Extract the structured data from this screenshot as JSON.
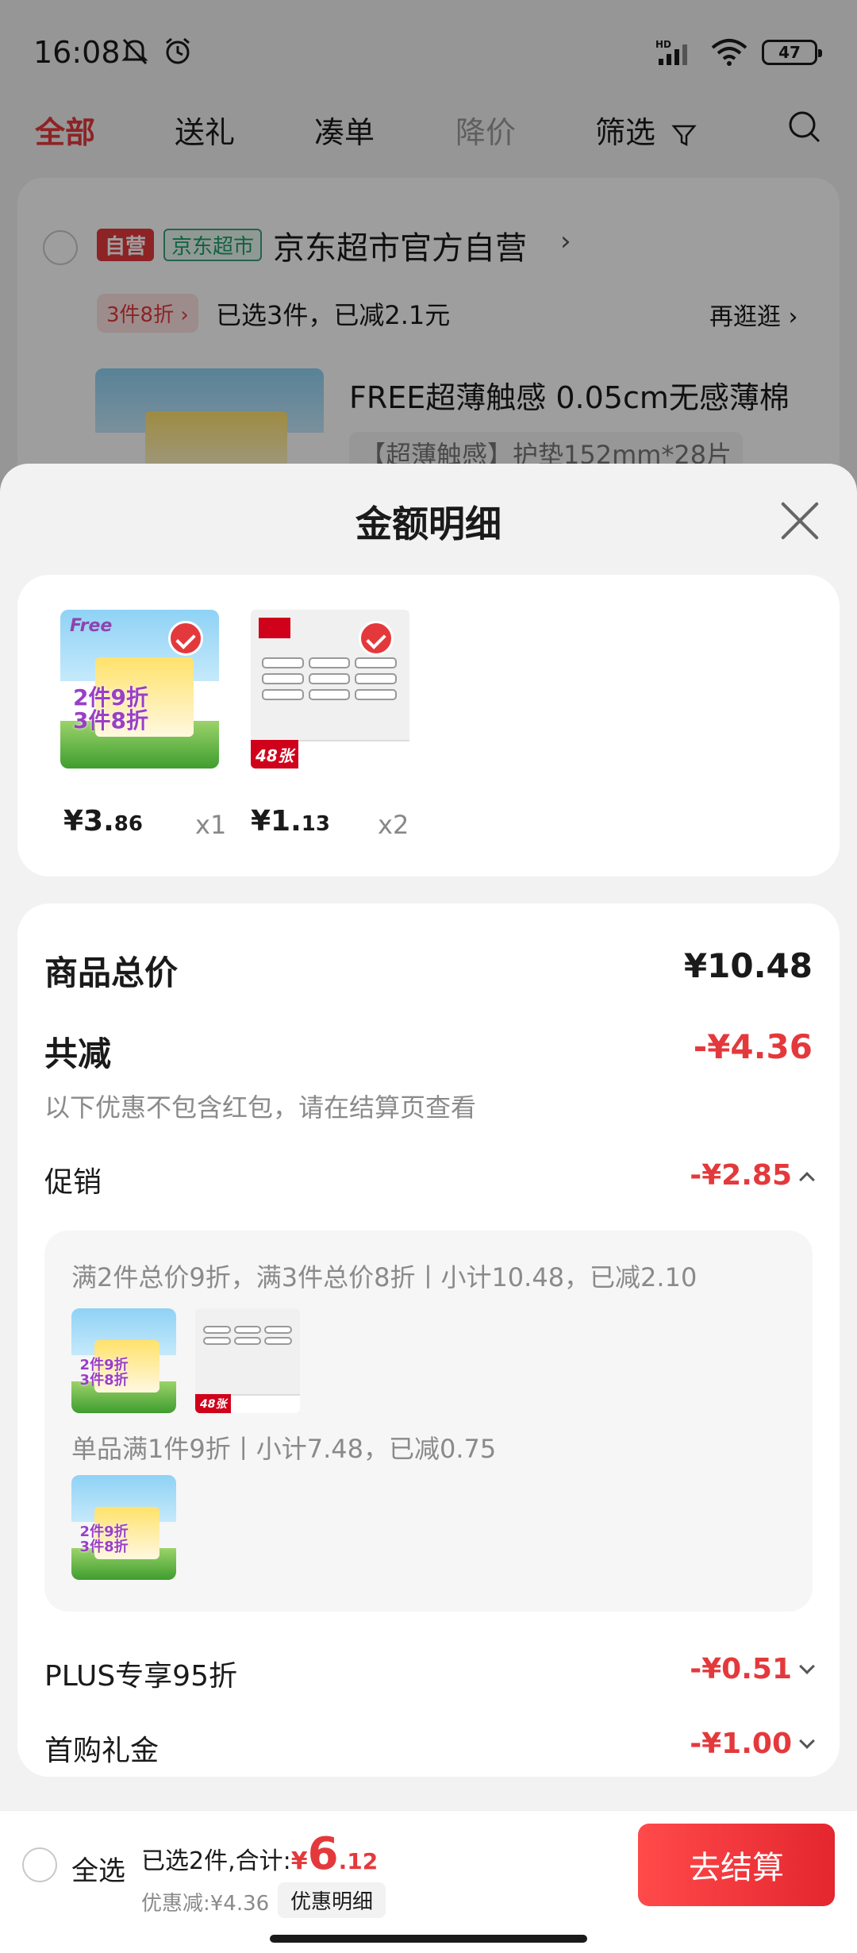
{
  "status_bar": {
    "time": "16:08",
    "battery": "47",
    "network": "HD"
  },
  "filter_tabs": [
    {
      "label": "全部",
      "state": "active"
    },
    {
      "label": "送礼",
      "state": "normal"
    },
    {
      "label": "凑单",
      "state": "normal"
    },
    {
      "label": "降价",
      "state": "disabled"
    },
    {
      "label": "筛选",
      "state": "normal"
    }
  ],
  "shop_card": {
    "tag_self": "自营",
    "tag_store": "京东超市",
    "shop_name": "京东超市官方自营",
    "promo_tag": "3件8折",
    "promo_text": "已选3件，已减2.1元",
    "browse_more": "再逛逛",
    "product_title": "FREE超薄触感 0.05cm无感薄棉",
    "product_spec": "【超薄触感】护垫152mm*28片"
  },
  "sheet": {
    "title": "金额明细",
    "items": [
      {
        "price_int": "¥3.",
        "price_dec": "86",
        "qty": "x1"
      },
      {
        "price_int": "¥1.",
        "price_dec": "13",
        "qty": "x2"
      }
    ],
    "thumb_pad": {
      "logo": "Free",
      "line1": "2件9折",
      "line2": "3件8折"
    },
    "thumb_label": {
      "count": "48张"
    },
    "total_label": "商品总价",
    "total_value": "¥10.48",
    "discount_label": "共减",
    "discount_value": "-¥4.36",
    "discount_note": "以下优惠不包含红包，请在结算页查看",
    "promo_label": "促销",
    "promo_value": "-¥2.85",
    "promo_rule1": "满2件总价9折，满3件总价8折丨小计10.48，已减2.10",
    "promo_rule2": "单品满1件9折丨小计7.48，已减0.75",
    "plus_label": "PLUS专享95折",
    "plus_value": "-¥0.51",
    "first_label": "首购礼金",
    "first_value": "-¥1.00"
  },
  "bottom_bar": {
    "select_all": "全选",
    "selected_text": "已选2件,合计:",
    "currency": "¥",
    "total_int": "6",
    "total_dec": ".12",
    "saved_text": "优惠减:¥4.36",
    "detail_btn": "优惠明细",
    "checkout_btn": "去结算"
  },
  "colors": {
    "accent": "#e4393c",
    "green": "#1b9e6f",
    "background": "#f2f2f2"
  }
}
